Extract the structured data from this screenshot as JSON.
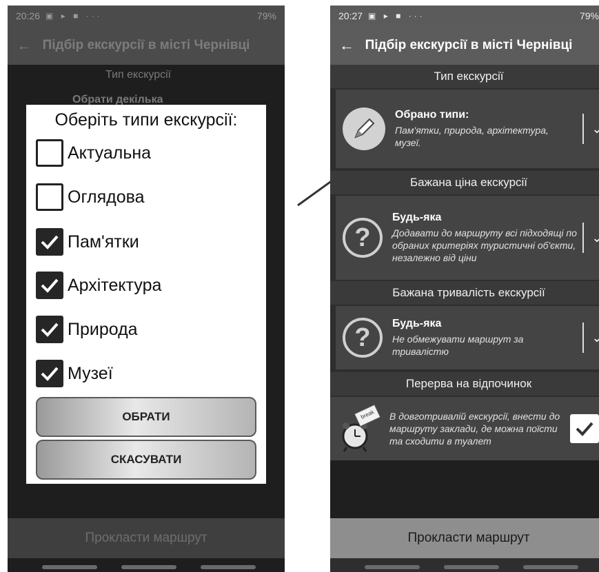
{
  "left": {
    "status": {
      "time": "20:26",
      "icons": "▣ ▸ ■ ···",
      "battery": "79%"
    },
    "appbar": {
      "title": "Підбір екскурсії в місті Чернівці"
    },
    "bg_header": "Тип екскурсії",
    "bg_subtitle": "Обрати декілька",
    "dialog": {
      "title": "Оберіть типи екскурсії:",
      "options": [
        {
          "label": "Актуальна",
          "checked": false
        },
        {
          "label": "Оглядова",
          "checked": false
        },
        {
          "label": "Пам'ятки",
          "checked": true
        },
        {
          "label": "Архітектура",
          "checked": true
        },
        {
          "label": "Природа",
          "checked": true
        },
        {
          "label": "Музеї",
          "checked": true
        }
      ],
      "ok_label": "ОБРАТИ",
      "cancel_label": "СКАСУВАТИ"
    },
    "bottom_button": "Прокласти маршрут"
  },
  "right": {
    "status": {
      "time": "20:27",
      "icons": "▣ ▸ ■ ···",
      "battery": "79%"
    },
    "appbar": {
      "title": "Підбір екскурсії в місті Чернівці"
    },
    "sections": [
      {
        "header": "Тип екскурсії",
        "title": "Обрано типи:",
        "desc": "Пам'ятки, природа, архітектура, музеї.",
        "icon": "pencil-icon"
      },
      {
        "header": "Бажана ціна екскурсії",
        "title": "Будь-яка",
        "desc": "Додавати до маршруту всі підходящі по обраних критеріях туристичні об'єкти, незалежно від ціни",
        "icon": "question-icon"
      },
      {
        "header": "Бажана тривалість екскурсії",
        "title": "Будь-яка",
        "desc": "Не обмежувати маршрут за тривалістю",
        "icon": "question-icon"
      }
    ],
    "break": {
      "header": "Перерва на відпочинок",
      "text": "В довготривалій екскурсії, внести до маршруту заклади, де можна поїсти та сходити в туалет",
      "checked": true,
      "clock_note": "break"
    },
    "bottom_button": "Прокласти маршрут"
  }
}
